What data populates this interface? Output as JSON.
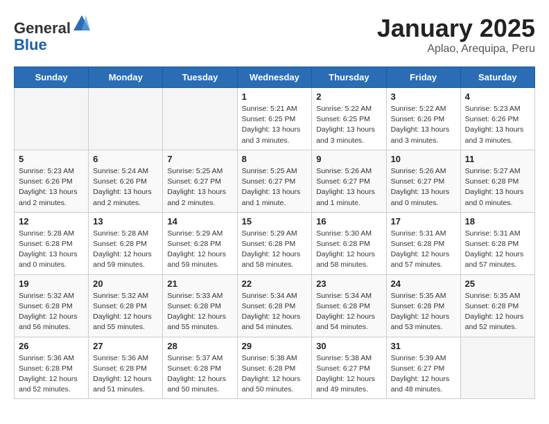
{
  "header": {
    "logo_general": "General",
    "logo_blue": "Blue",
    "title": "January 2025",
    "location": "Aplao, Arequipa, Peru"
  },
  "days_of_week": [
    "Sunday",
    "Monday",
    "Tuesday",
    "Wednesday",
    "Thursday",
    "Friday",
    "Saturday"
  ],
  "weeks": [
    [
      {
        "day": "",
        "info": ""
      },
      {
        "day": "",
        "info": ""
      },
      {
        "day": "",
        "info": ""
      },
      {
        "day": "1",
        "info": "Sunrise: 5:21 AM\nSunset: 6:25 PM\nDaylight: 13 hours and 3 minutes."
      },
      {
        "day": "2",
        "info": "Sunrise: 5:22 AM\nSunset: 6:25 PM\nDaylight: 13 hours and 3 minutes."
      },
      {
        "day": "3",
        "info": "Sunrise: 5:22 AM\nSunset: 6:26 PM\nDaylight: 13 hours and 3 minutes."
      },
      {
        "day": "4",
        "info": "Sunrise: 5:23 AM\nSunset: 6:26 PM\nDaylight: 13 hours and 3 minutes."
      }
    ],
    [
      {
        "day": "5",
        "info": "Sunrise: 5:23 AM\nSunset: 6:26 PM\nDaylight: 13 hours and 2 minutes."
      },
      {
        "day": "6",
        "info": "Sunrise: 5:24 AM\nSunset: 6:26 PM\nDaylight: 13 hours and 2 minutes."
      },
      {
        "day": "7",
        "info": "Sunrise: 5:25 AM\nSunset: 6:27 PM\nDaylight: 13 hours and 2 minutes."
      },
      {
        "day": "8",
        "info": "Sunrise: 5:25 AM\nSunset: 6:27 PM\nDaylight: 13 hours and 1 minute."
      },
      {
        "day": "9",
        "info": "Sunrise: 5:26 AM\nSunset: 6:27 PM\nDaylight: 13 hours and 1 minute."
      },
      {
        "day": "10",
        "info": "Sunrise: 5:26 AM\nSunset: 6:27 PM\nDaylight: 13 hours and 0 minutes."
      },
      {
        "day": "11",
        "info": "Sunrise: 5:27 AM\nSunset: 6:28 PM\nDaylight: 13 hours and 0 minutes."
      }
    ],
    [
      {
        "day": "12",
        "info": "Sunrise: 5:28 AM\nSunset: 6:28 PM\nDaylight: 13 hours and 0 minutes."
      },
      {
        "day": "13",
        "info": "Sunrise: 5:28 AM\nSunset: 6:28 PM\nDaylight: 12 hours and 59 minutes."
      },
      {
        "day": "14",
        "info": "Sunrise: 5:29 AM\nSunset: 6:28 PM\nDaylight: 12 hours and 59 minutes."
      },
      {
        "day": "15",
        "info": "Sunrise: 5:29 AM\nSunset: 6:28 PM\nDaylight: 12 hours and 58 minutes."
      },
      {
        "day": "16",
        "info": "Sunrise: 5:30 AM\nSunset: 6:28 PM\nDaylight: 12 hours and 58 minutes."
      },
      {
        "day": "17",
        "info": "Sunrise: 5:31 AM\nSunset: 6:28 PM\nDaylight: 12 hours and 57 minutes."
      },
      {
        "day": "18",
        "info": "Sunrise: 5:31 AM\nSunset: 6:28 PM\nDaylight: 12 hours and 57 minutes."
      }
    ],
    [
      {
        "day": "19",
        "info": "Sunrise: 5:32 AM\nSunset: 6:28 PM\nDaylight: 12 hours and 56 minutes."
      },
      {
        "day": "20",
        "info": "Sunrise: 5:32 AM\nSunset: 6:28 PM\nDaylight: 12 hours and 55 minutes."
      },
      {
        "day": "21",
        "info": "Sunrise: 5:33 AM\nSunset: 6:28 PM\nDaylight: 12 hours and 55 minutes."
      },
      {
        "day": "22",
        "info": "Sunrise: 5:34 AM\nSunset: 6:28 PM\nDaylight: 12 hours and 54 minutes."
      },
      {
        "day": "23",
        "info": "Sunrise: 5:34 AM\nSunset: 6:28 PM\nDaylight: 12 hours and 54 minutes."
      },
      {
        "day": "24",
        "info": "Sunrise: 5:35 AM\nSunset: 6:28 PM\nDaylight: 12 hours and 53 minutes."
      },
      {
        "day": "25",
        "info": "Sunrise: 5:35 AM\nSunset: 6:28 PM\nDaylight: 12 hours and 52 minutes."
      }
    ],
    [
      {
        "day": "26",
        "info": "Sunrise: 5:36 AM\nSunset: 6:28 PM\nDaylight: 12 hours and 52 minutes."
      },
      {
        "day": "27",
        "info": "Sunrise: 5:36 AM\nSunset: 6:28 PM\nDaylight: 12 hours and 51 minutes."
      },
      {
        "day": "28",
        "info": "Sunrise: 5:37 AM\nSunset: 6:28 PM\nDaylight: 12 hours and 50 minutes."
      },
      {
        "day": "29",
        "info": "Sunrise: 5:38 AM\nSunset: 6:28 PM\nDaylight: 12 hours and 50 minutes."
      },
      {
        "day": "30",
        "info": "Sunrise: 5:38 AM\nSunset: 6:27 PM\nDaylight: 12 hours and 49 minutes."
      },
      {
        "day": "31",
        "info": "Sunrise: 5:39 AM\nSunset: 6:27 PM\nDaylight: 12 hours and 48 minutes."
      },
      {
        "day": "",
        "info": ""
      }
    ]
  ]
}
